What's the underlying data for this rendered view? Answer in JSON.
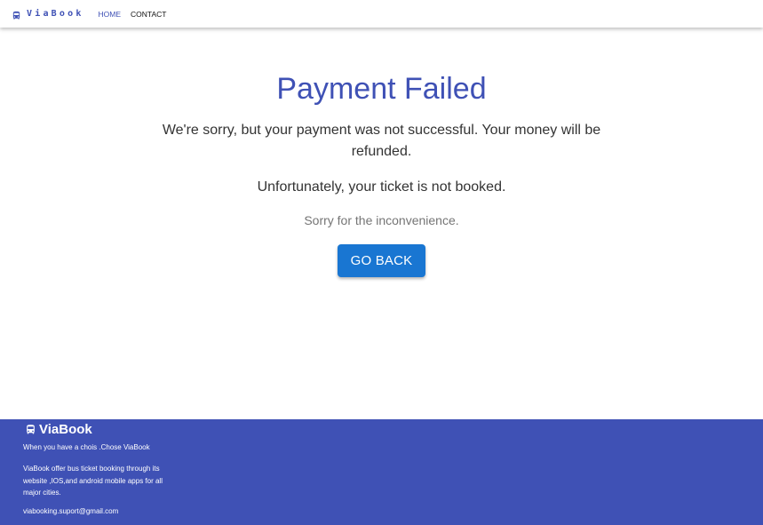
{
  "navbar": {
    "brand": "ViaBook",
    "brand_icon": "bus-icon",
    "links": [
      {
        "label": "HOME"
      },
      {
        "label": "CONTACT"
      }
    ]
  },
  "main": {
    "title": "Payment Failed",
    "message_refund": "We're sorry, but your payment was not successful. Your money will be refunded.",
    "message_ticket": "Unfortunately, your ticket is not booked.",
    "message_apology": "Sorry for the inconvenience.",
    "button_label": "GO BACK"
  },
  "footer": {
    "brand": "ViaBook",
    "brand_icon": "bus-icon",
    "tagline": "When you have a chois .Chose ViaBook",
    "description": "ViaBook offer bus ticket booking through its website ,IOS,and android mobile apps for all major cities.",
    "email": "viabooking.suport@gmail.com"
  },
  "colors": {
    "primary": "#3f51b5",
    "button": "#1976d2",
    "footer_bg": "#3f51b5"
  }
}
